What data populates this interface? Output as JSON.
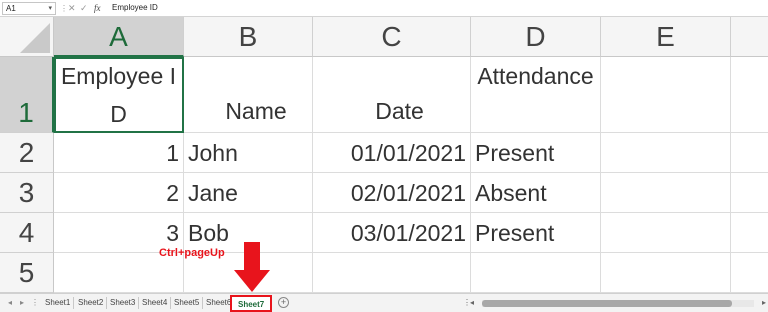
{
  "formula_bar": {
    "name_box": "A1",
    "fx_label": "fx",
    "formula_value": "Employee ID"
  },
  "columns": [
    "A",
    "B",
    "C",
    "D",
    "E"
  ],
  "rows": [
    "1",
    "2",
    "3",
    "4",
    "5"
  ],
  "header_row": {
    "a": "Employee ID",
    "b": "Name",
    "c": "Date",
    "d": "Attendance"
  },
  "table_rows": [
    {
      "id": "1",
      "name": "John",
      "date": "01/01/2021",
      "status": "Present"
    },
    {
      "id": "2",
      "name": "Jane",
      "date": "02/01/2021",
      "status": "Absent"
    },
    {
      "id": "3",
      "name": "Bob",
      "date": "03/01/2021",
      "status": "Present"
    }
  ],
  "annotation": {
    "text": "Ctrl+pageUp",
    "color": "#e8141c"
  },
  "sheet_tabs": [
    "Sheet1",
    "Sheet2",
    "Sheet3",
    "Sheet4",
    "Sheet5",
    "Sheet6",
    "Sheet7"
  ],
  "active_tab": "Sheet7",
  "colors": {
    "accent_green": "#217346",
    "highlight_red": "#e8141c"
  }
}
